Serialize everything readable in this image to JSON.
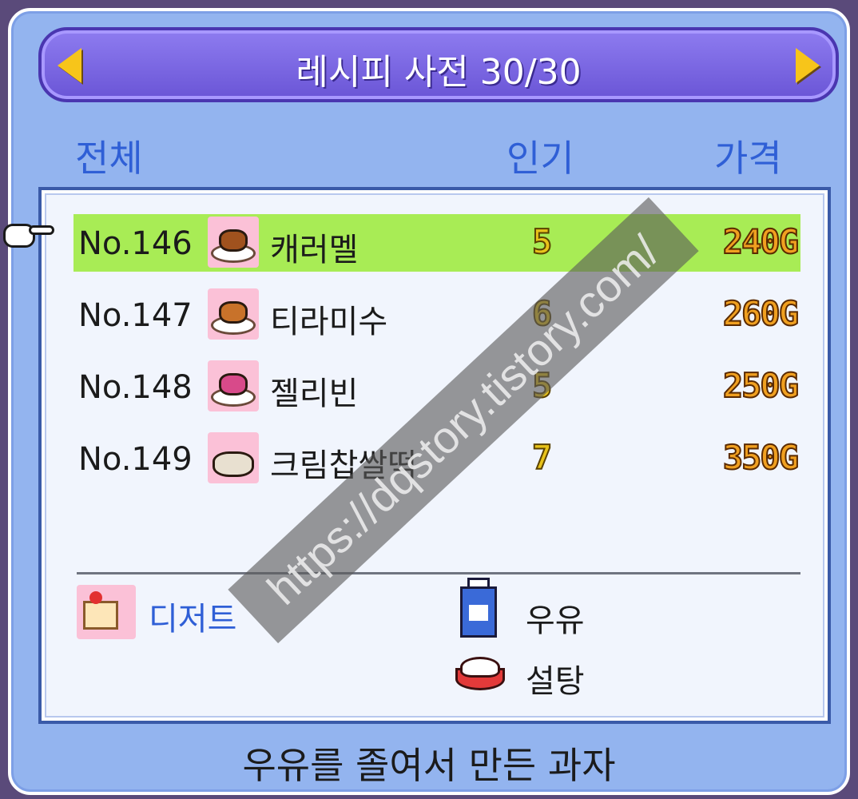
{
  "window": {
    "title": "레시피 사전 30/30"
  },
  "tabs": {
    "all": "전체",
    "popularity": "인기",
    "price": "가격"
  },
  "recipes": [
    {
      "no": "No.146",
      "name": "캐러멜",
      "popularity": "5",
      "price": "240G",
      "selected": true,
      "icon": "caramel-icon"
    },
    {
      "no": "No.147",
      "name": "티라미수",
      "popularity": "6",
      "price": "260G",
      "selected": false,
      "icon": "tiramisu-icon"
    },
    {
      "no": "No.148",
      "name": "젤리빈",
      "popularity": "5",
      "price": "250G",
      "selected": false,
      "icon": "jellybean-icon"
    },
    {
      "no": "No.149",
      "name": "크림찹쌀떡",
      "popularity": "7",
      "price": "350G",
      "selected": false,
      "icon": "cream-rice-cake-icon"
    }
  ],
  "detail": {
    "category": "디저트",
    "ingredients": [
      "우유",
      "설탕"
    ],
    "description": "우유를 졸여서 만든 과자"
  },
  "watermark": "https://dqstory.tistory.com/",
  "colors": {
    "selected_row": "#a8ec55",
    "tab_text": "#2f5fd6",
    "title_bar": "#7a66e6"
  }
}
